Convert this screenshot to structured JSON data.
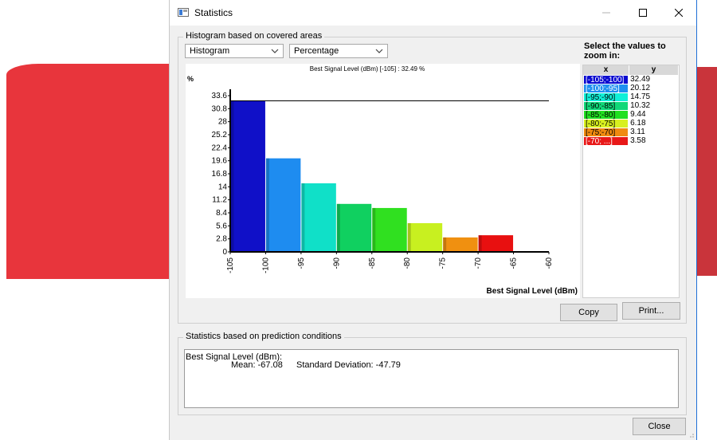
{
  "window": {
    "title": "Statistics",
    "controls": {
      "minimize": "—",
      "maximize": "☐",
      "close": "✕"
    }
  },
  "histogram_group": {
    "label": "Histogram based on covered areas",
    "type_select": "Histogram",
    "mode_select": "Percentage",
    "zoom_prompt": "Select the values to zoom in:"
  },
  "chart_data": {
    "type": "bar",
    "title": "Best Signal Level (dBm) [-105] : 32.49 %",
    "ylabel": "%",
    "xlabel": "Best Signal Level (dBm)",
    "x_ticks": [
      "-105",
      "-100",
      "-95",
      "-90",
      "-85",
      "-80",
      "-75",
      "-70",
      "-65",
      "-60"
    ],
    "y_ticks": [
      "0",
      "2.8",
      "5.6",
      "8.4",
      "11.2",
      "14",
      "16.8",
      "19.6",
      "22.4",
      "25.2",
      "28",
      "30.8",
      "33.6"
    ],
    "xlim": [
      -105,
      -60
    ],
    "ylim": [
      0,
      33.6
    ],
    "reference_line": 32.49,
    "bins": [
      {
        "from": -105,
        "to": -100,
        "value": 32.49,
        "color": "#1010c8"
      },
      {
        "from": -100,
        "to": -95,
        "value": 20.12,
        "color": "#1e8cf0"
      },
      {
        "from": -95,
        "to": -90,
        "value": 14.75,
        "color": "#10e0c8"
      },
      {
        "from": -90,
        "to": -85,
        "value": 10.32,
        "color": "#10d060"
      },
      {
        "from": -85,
        "to": -80,
        "value": 9.44,
        "color": "#30e020"
      },
      {
        "from": -80,
        "to": -75,
        "value": 6.18,
        "color": "#c8f020"
      },
      {
        "from": -75,
        "to": -70,
        "value": 3.11,
        "color": "#f09010"
      },
      {
        "from": -70,
        "to": -65,
        "value": 3.58,
        "color": "#e81010"
      }
    ]
  },
  "zoom_table": {
    "headers": [
      "x",
      "y"
    ],
    "rows": [
      {
        "x": "[-105;-100]",
        "y": "32.49",
        "color": "#0a0ad0"
      },
      {
        "x": "[-100;-95]",
        "y": "20.12",
        "color": "#1e90f0"
      },
      {
        "x": "[-95;-90]",
        "y": "14.75",
        "color": "#10f0d8"
      },
      {
        "x": "[-90;-85]",
        "y": "10.32",
        "color": "#10d878"
      },
      {
        "x": "[-85;-80]",
        "y": "9.44",
        "color": "#20e020"
      },
      {
        "x": "[-80;-75]",
        "y": "6.18",
        "color": "#d8f020"
      },
      {
        "x": "[-75;-70]",
        "y": "3.11",
        "color": "#f08a10"
      },
      {
        "x": "[-70; ...]",
        "y": "3.58",
        "color": "#e81818"
      }
    ]
  },
  "buttons": {
    "copy": "Copy",
    "print": "Print...",
    "close": "Close"
  },
  "prediction_group": {
    "label": "Statistics based on prediction conditions",
    "line1": "Best Signal Level (dBm):",
    "mean": "Mean: -67.08",
    "std": "Standard Deviation: -47.79"
  }
}
